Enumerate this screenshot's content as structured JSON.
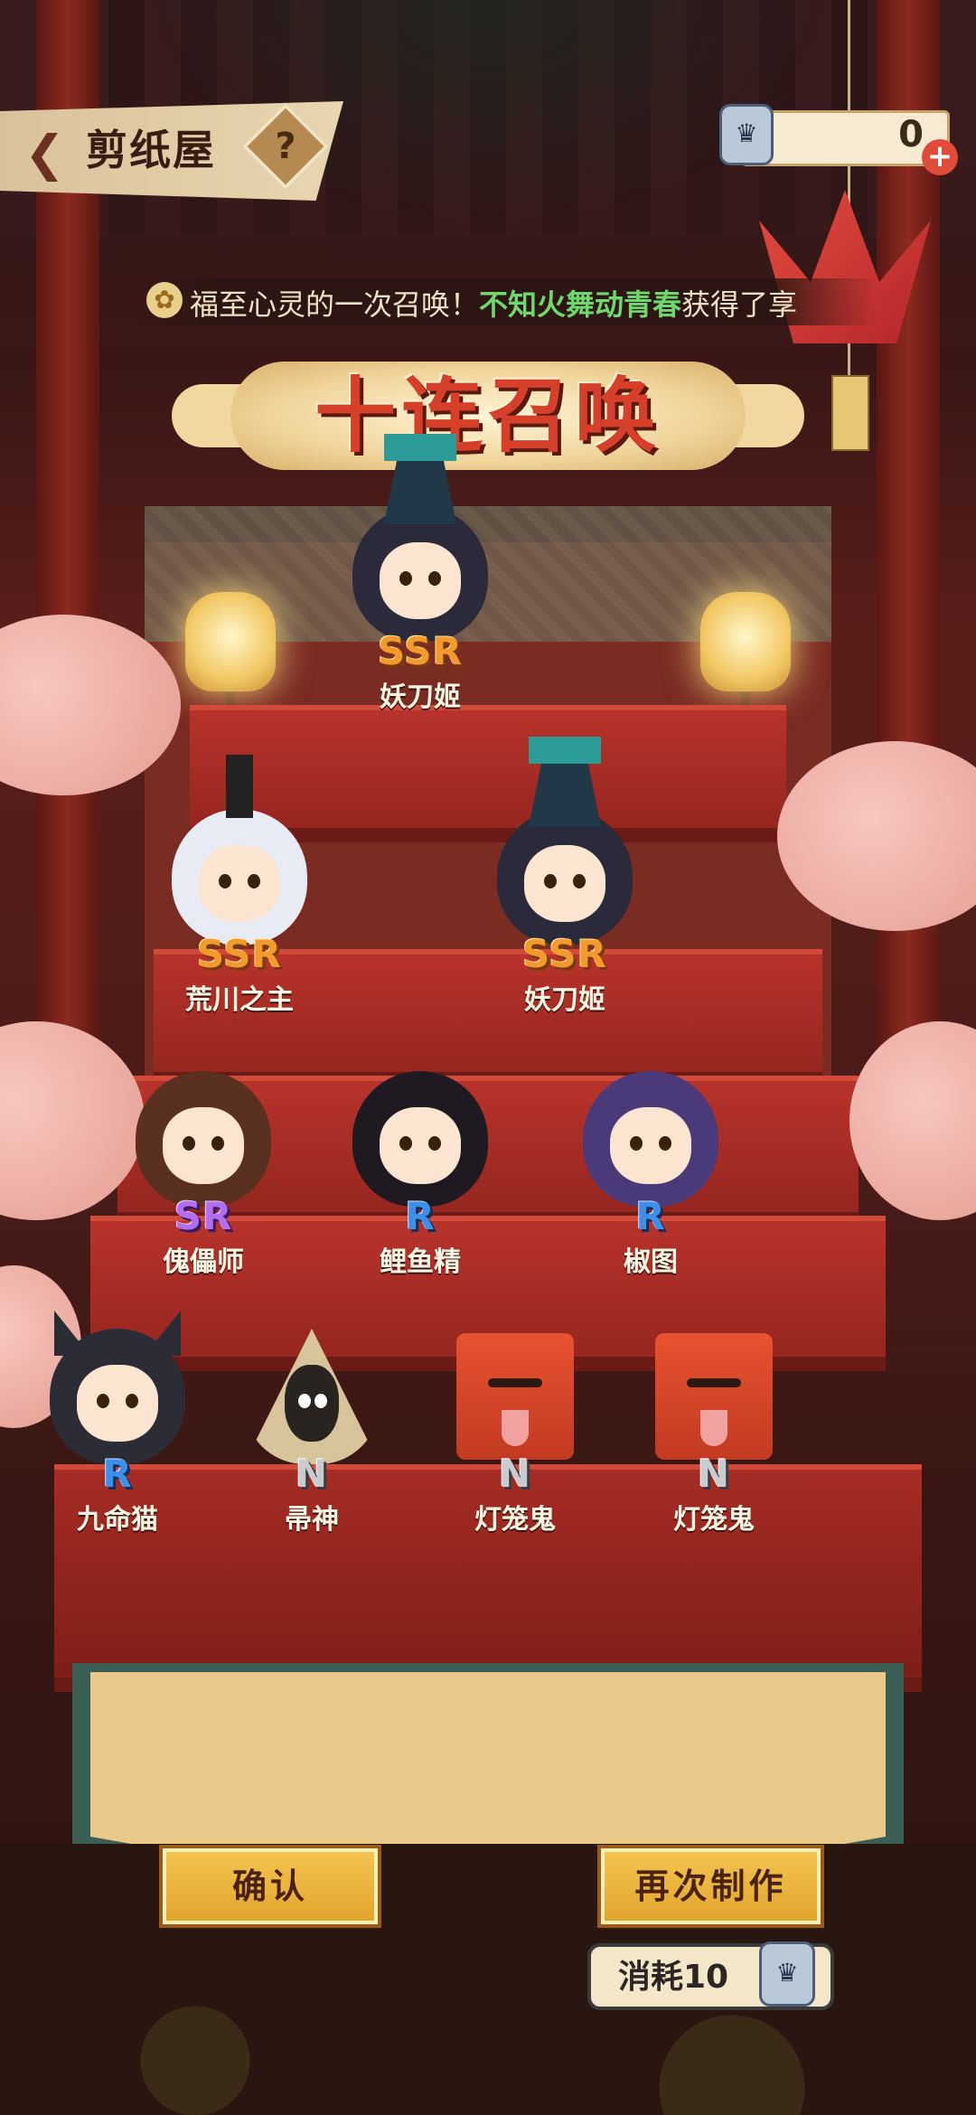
{
  "header": {
    "title": "剪纸屋",
    "help_label": "?",
    "currency_value": "0",
    "currency_plus": "+"
  },
  "ticker": {
    "prefix": "福至心灵的一次召唤！",
    "player": "不知火舞动青春",
    "suffix": "获得了",
    "end": "享"
  },
  "banner": {
    "title": "十连召唤"
  },
  "results": [
    {
      "rarity": "SSR",
      "name": "妖刀姬"
    },
    {
      "rarity": "SSR",
      "name": "荒川之主"
    },
    {
      "rarity": "SSR",
      "name": "妖刀姬"
    },
    {
      "rarity": "SR",
      "name": "傀儡师"
    },
    {
      "rarity": "R",
      "name": "鲤鱼精"
    },
    {
      "rarity": "R",
      "name": "椒图"
    },
    {
      "rarity": "R",
      "name": "九命猫"
    },
    {
      "rarity": "N",
      "name": "帚神"
    },
    {
      "rarity": "N",
      "name": "灯笼鬼"
    },
    {
      "rarity": "N",
      "name": "灯笼鬼"
    }
  ],
  "actions": {
    "confirm_label": "确认",
    "again_label": "再次制作",
    "cost_label": "消耗10"
  },
  "colors": {
    "ssr": "#f39a2c",
    "sr": "#b26df0",
    "r": "#3e8fe8",
    "n": "#c9cbd0"
  }
}
